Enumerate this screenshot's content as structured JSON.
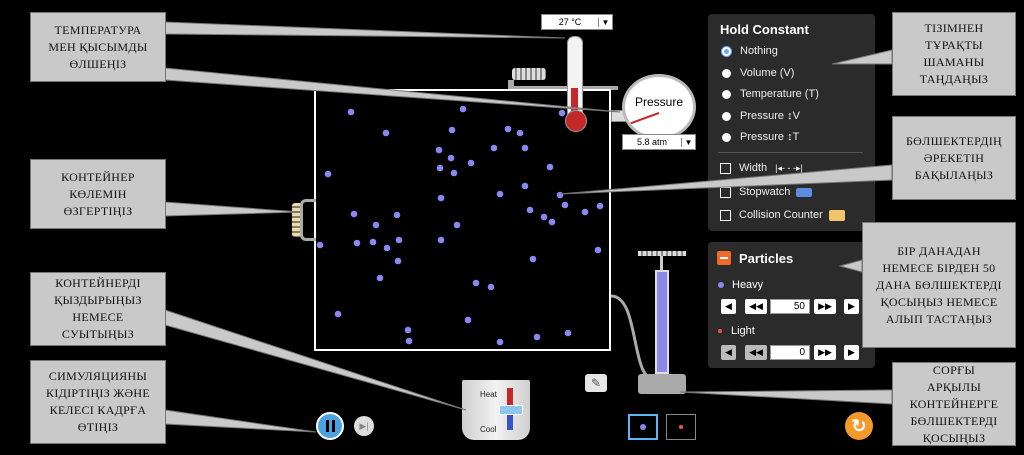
{
  "thermometer": {
    "value": "27 °C"
  },
  "gauge": {
    "label": "Pressure",
    "value": "5.8 atm"
  },
  "hold_constant": {
    "title": "Hold Constant",
    "options": [
      "Nothing",
      "Volume (V)",
      "Temperature (T)",
      "Pressure ↕V",
      "Pressure ↕T"
    ],
    "selected": 0
  },
  "tools": {
    "width": "Width",
    "stopwatch": "Stopwatch",
    "collision_counter": "Collision Counter"
  },
  "particles": {
    "title": "Particles",
    "heavy_label": "Heavy",
    "heavy_count": "50",
    "light_label": "Light",
    "light_count": "0"
  },
  "heater": {
    "heat": "Heat",
    "cool": "Cool"
  },
  "callouts": {
    "measure": "Температура мен қысымды өлшеңіз",
    "volume": "Контейнер көлемін өзгертіңіз",
    "heat": "Контейнерді қыздырыңыз немесе суытыңыз",
    "pause": "Симуляцияны кідіртіңіз және келесі кадрға өтіңіз",
    "hold": "Тізімнен тұрақты шаманы таңдаңыз",
    "observe": "Бөлшектердің әрекетін бақылаңыз",
    "add_remove": "Бір данадан немесе бірден 50 дана бөлшектерді қосыңыз немесе алып тастаңыз",
    "pump": "Сорғы арқылы контейнерге бөлшектерді қосыңыз"
  },
  "colors": {
    "heavy": "#8a88f0",
    "light": "#e85a3c",
    "accent": "#f39a2b"
  }
}
